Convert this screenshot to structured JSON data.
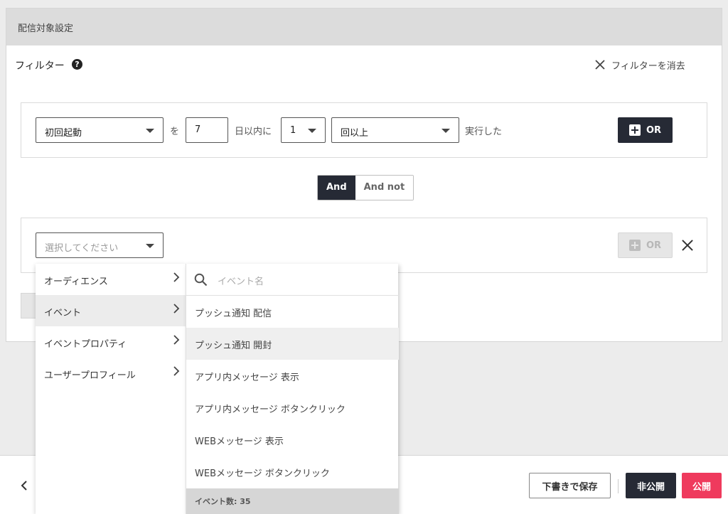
{
  "panel": {
    "title": "配信対象設定"
  },
  "filter": {
    "label": "フィルター",
    "help": "?",
    "clear_label": "フィルターを消去"
  },
  "condition1": {
    "event_select": "初回起動",
    "particle": "を",
    "days": "7",
    "within_label": "日以内に",
    "count_select": "1",
    "compare_select": "回以上",
    "executed_label": "実行した",
    "or_label": "OR"
  },
  "logic_toggle": {
    "and_label": "And",
    "and_not_label": "And not",
    "selected": "And"
  },
  "condition2": {
    "select_placeholder": "選択してください",
    "or_label": "OR"
  },
  "dropdown": {
    "categories": [
      {
        "label": "オーディエンス"
      },
      {
        "label": "イベント"
      },
      {
        "label": "イベントプロパティ"
      },
      {
        "label": "ユーザープロフィール"
      }
    ],
    "active_category": "イベント",
    "search_placeholder": "イベント名",
    "events": [
      {
        "label": "プッシュ通知 配信"
      },
      {
        "label": "プッシュ通知 開封"
      },
      {
        "label": "アプリ内メッセージ 表示"
      },
      {
        "label": "アプリ内メッセージ ボタンクリック"
      },
      {
        "label": "WEBメッセージ 表示"
      },
      {
        "label": "WEBメッセージ ボタンクリック"
      }
    ],
    "hovered_event": "プッシュ通知 開封",
    "event_count": "イベント数: 35"
  },
  "footer": {
    "back": "‹",
    "save_draft": "下書きで保存",
    "private": "非公開",
    "publish": "公開"
  },
  "colors": {
    "dark": "#262a35",
    "publish": "#ef3a5d"
  }
}
